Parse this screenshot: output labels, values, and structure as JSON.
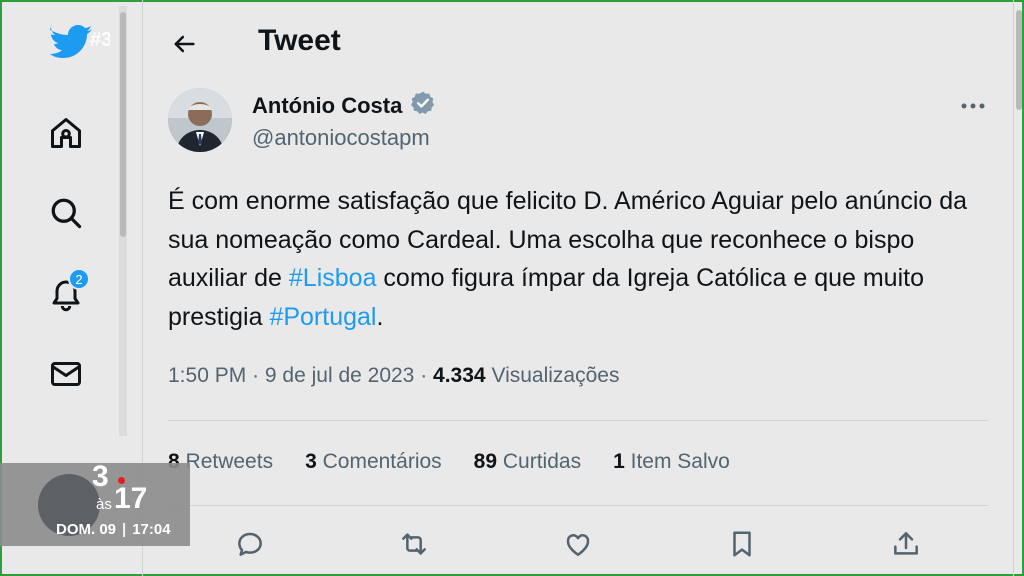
{
  "header": {
    "title": "Tweet"
  },
  "nav": {
    "brand_watermark": "#3",
    "notifications_badge": "2"
  },
  "author": {
    "name": "António Costa",
    "handle": "@antoniocostapm",
    "verified": true
  },
  "tweet": {
    "text_part1": "É com enorme satisfação que felicito D. Américo Aguiar pelo anúncio da sua nomeação como Cardeal. Uma escolha que reconhece o bispo auxiliar de ",
    "hashtag1": "#Lisboa",
    "text_part2": " como figura ímpar da Igreja Católica e que muito prestigia ",
    "hashtag2": "#Portugal",
    "text_part3": ".",
    "time": "1:50 PM",
    "date": "9 de jul de 2023",
    "views_count": "4.334",
    "views_label": "Visualizações"
  },
  "stats": [
    {
      "count": "8",
      "label": "Retweets"
    },
    {
      "count": "3",
      "label": "Comentários"
    },
    {
      "count": "89",
      "label": "Curtidas"
    },
    {
      "count": "1",
      "label": "Item Salvo"
    }
  ],
  "tv_overlay": {
    "logo_number": "3",
    "logo_small": "às",
    "logo_big": "17",
    "day": "DOM. 09",
    "time": "17:04"
  },
  "colors": {
    "accent": "#1d9bf0",
    "background": "#e9e9e9",
    "muted_text": "#536471"
  }
}
